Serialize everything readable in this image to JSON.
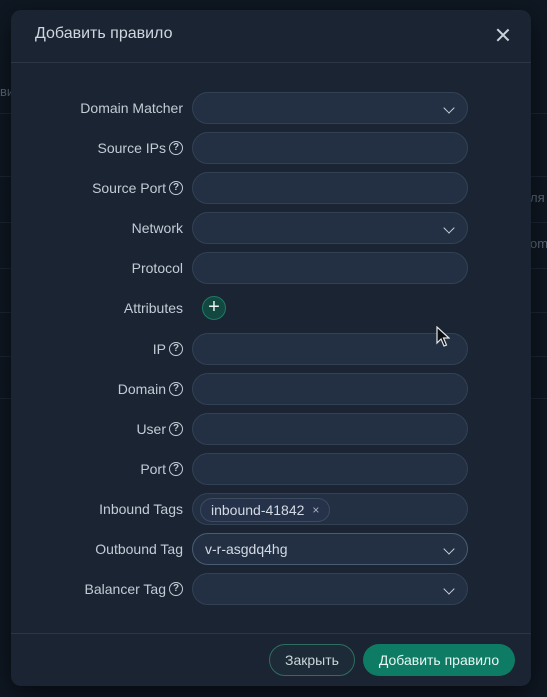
{
  "background": {
    "text_left": "ви",
    "text_right_1": "ля",
    "text_right_2": "oma"
  },
  "modal": {
    "title": "Добавить правило",
    "fields": [
      {
        "label": "Domain Matcher",
        "help": false,
        "type": "select",
        "value": ""
      },
      {
        "label": "Source IPs",
        "help": true,
        "type": "input",
        "value": ""
      },
      {
        "label": "Source Port",
        "help": true,
        "type": "input",
        "value": ""
      },
      {
        "label": "Network",
        "help": false,
        "type": "select",
        "value": ""
      },
      {
        "label": "Protocol",
        "help": false,
        "type": "input",
        "value": ""
      },
      {
        "label": "Attributes",
        "help": false,
        "type": "add",
        "value": "+"
      },
      {
        "label": "IP",
        "help": true,
        "type": "input",
        "value": ""
      },
      {
        "label": "Domain",
        "help": true,
        "type": "input",
        "value": ""
      },
      {
        "label": "User",
        "help": true,
        "type": "input",
        "value": ""
      },
      {
        "label": "Port",
        "help": true,
        "type": "input",
        "value": ""
      },
      {
        "label": "Inbound Tags",
        "help": false,
        "type": "tags",
        "value": "inbound-41842"
      },
      {
        "label": "Outbound Tag",
        "help": false,
        "type": "select",
        "value": "v-r-asgdq4hg"
      },
      {
        "label": "Balancer Tag",
        "help": true,
        "type": "select",
        "value": ""
      }
    ],
    "help_glyph": "?",
    "tag_remove_glyph": "×",
    "close_label": "Закрыть",
    "submit_label": "Добавить правило"
  },
  "colors": {
    "accent": "#0e7b64",
    "background": "#1a2433"
  }
}
